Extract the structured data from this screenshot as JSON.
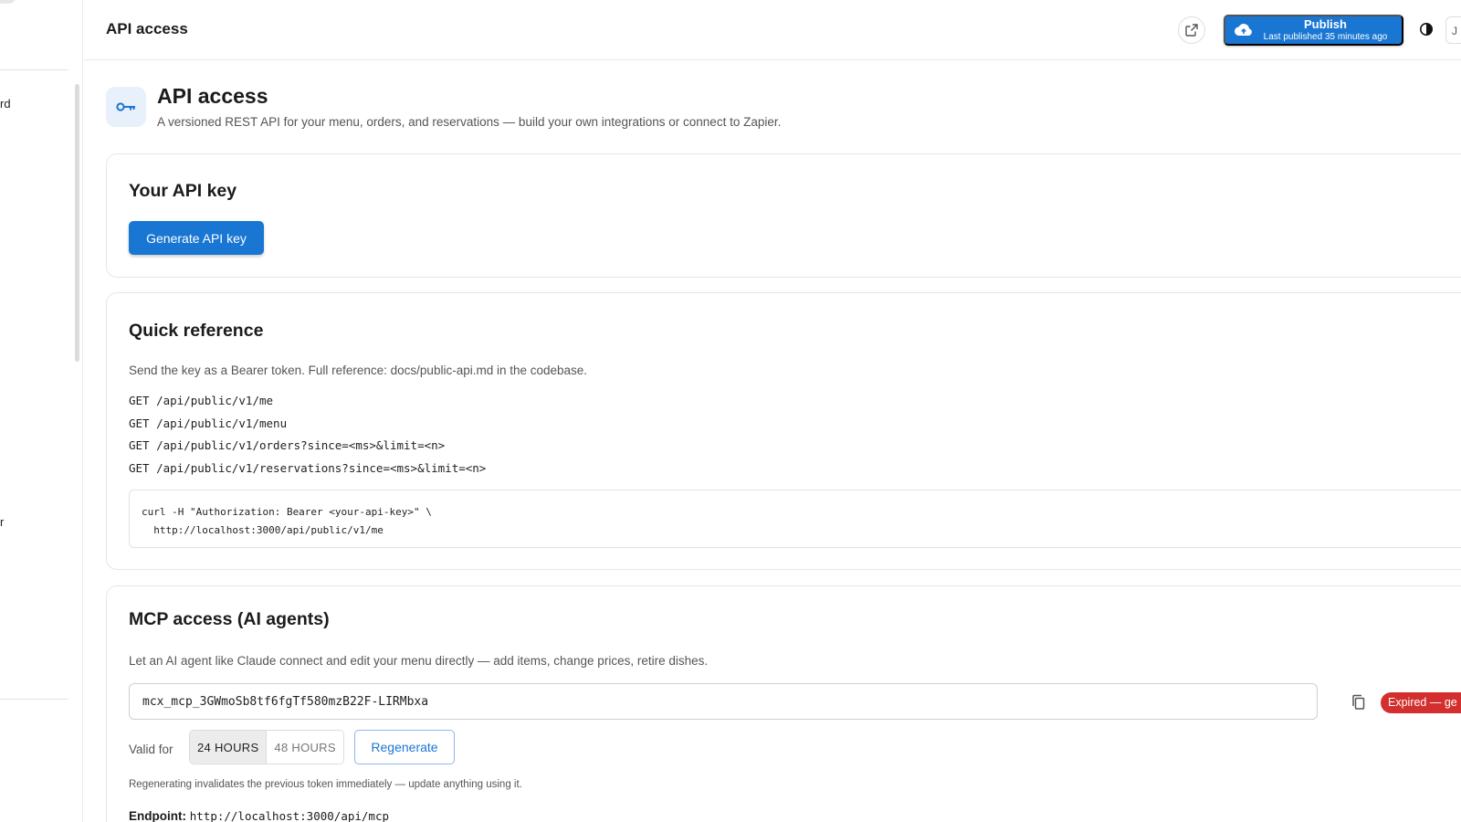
{
  "sidebar": {
    "fragments": [
      "rd",
      "r"
    ]
  },
  "header": {
    "title": "API access",
    "publish_label": "Publish",
    "publish_sub": "Last published 35 minutes ago",
    "edge_text": "J"
  },
  "page": {
    "title": "API access",
    "subtitle": "A versioned REST API for your menu, orders, and reservations — build your own integrations or connect to Zapier."
  },
  "api_key_card": {
    "title": "Your API key",
    "generate_label": "Generate API key"
  },
  "quick_ref": {
    "title": "Quick reference",
    "description": "Send the key as a Bearer token. Full reference: docs/public-api.md in the codebase.",
    "endpoints": [
      "GET /api/public/v1/me",
      "GET /api/public/v1/menu",
      "GET /api/public/v1/orders?since=<ms>&limit=<n>",
      "GET /api/public/v1/reservations?since=<ms>&limit=<n>"
    ],
    "curl_example": "curl -H \"Authorization: Bearer <your-api-key>\" \\\n  http://localhost:3000/api/public/v1/me"
  },
  "mcp": {
    "title": "MCP access (AI agents)",
    "description": "Let an AI agent like Claude connect and edit your menu directly — add items, change prices, retire dishes.",
    "token": "mcx_mcp_3GWmoSb8tf6fgTf580mzB22F-LIRMbxa",
    "status_badge": "Expired — ge",
    "valid_for_label": "Valid for",
    "duration_options": [
      "24 HOURS",
      "48 HOURS"
    ],
    "selected_duration": "24 HOURS",
    "regenerate_label": "Regenerate",
    "note": "Regenerating invalidates the previous token immediately — update anything using it.",
    "endpoint_label": "Endpoint:",
    "endpoint_url": "http://localhost:3000/api/mcp"
  },
  "colors": {
    "primary": "#1976d2",
    "danger": "#d32f2f",
    "icon_bg": "#e8f0fb"
  }
}
